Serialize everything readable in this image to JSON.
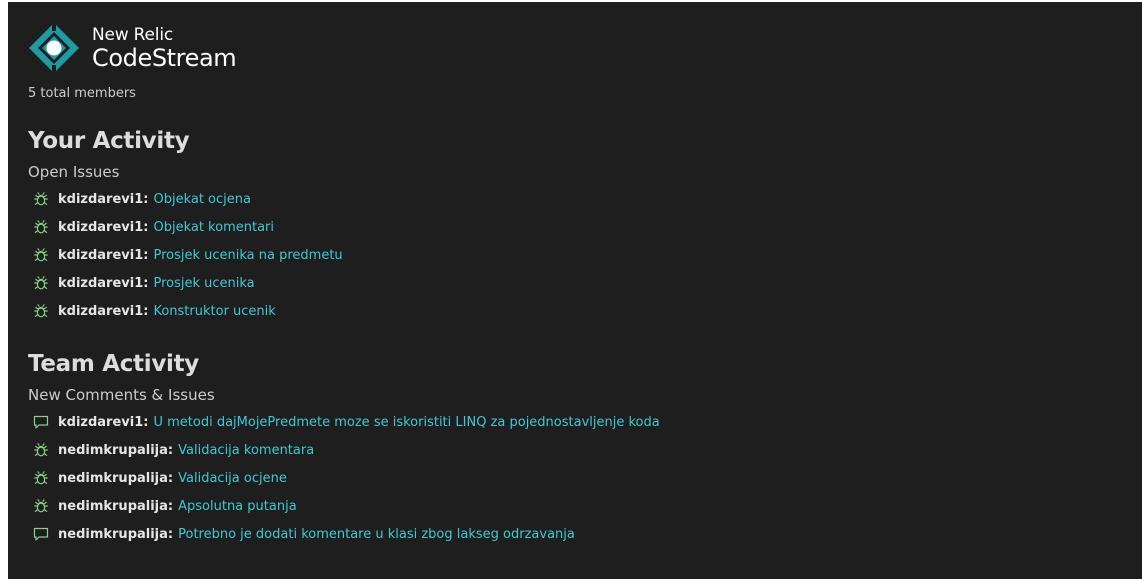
{
  "brand": {
    "line1": "New Relic",
    "line2": "CodeStream",
    "accent": "#1ce783"
  },
  "members_text": "5 total members",
  "your_activity": {
    "title": "Your Activity",
    "subtitle": "Open Issues",
    "items": [
      {
        "icon": "bug-icon",
        "author": "kdizdarevi1",
        "text": "Objekat ocjena"
      },
      {
        "icon": "bug-icon",
        "author": "kdizdarevi1",
        "text": "Objekat komentari"
      },
      {
        "icon": "bug-icon",
        "author": "kdizdarevi1",
        "text": "Prosjek ucenika na predmetu"
      },
      {
        "icon": "bug-icon",
        "author": "kdizdarevi1",
        "text": "Prosjek ucenika"
      },
      {
        "icon": "bug-icon",
        "author": "kdizdarevi1",
        "text": "Konstruktor ucenik"
      }
    ]
  },
  "team_activity": {
    "title": "Team Activity",
    "subtitle": "New Comments & Issues",
    "items": [
      {
        "icon": "comment-icon",
        "author": "kdizdarevi1",
        "text": "U metodi dajMojePredmete moze se iskoristiti LINQ za pojednostavljenje koda"
      },
      {
        "icon": "bug-icon",
        "author": "nedimkrupalija",
        "text": "Validacija komentara"
      },
      {
        "icon": "bug-icon",
        "author": "nedimkrupalija",
        "text": "Validacija ocjene"
      },
      {
        "icon": "bug-icon",
        "author": "nedimkrupalija",
        "text": "Apsolutna putanja"
      },
      {
        "icon": "comment-icon",
        "author": "nedimkrupalija",
        "text": "Potrebno je dodati komentare u klasi zbog lakseg odrzavanja"
      }
    ]
  },
  "colors": {
    "background": "#1e1e1e",
    "link": "#3dc9d6",
    "icon": "#89d185",
    "logo_teal": "#1e9aa3"
  }
}
